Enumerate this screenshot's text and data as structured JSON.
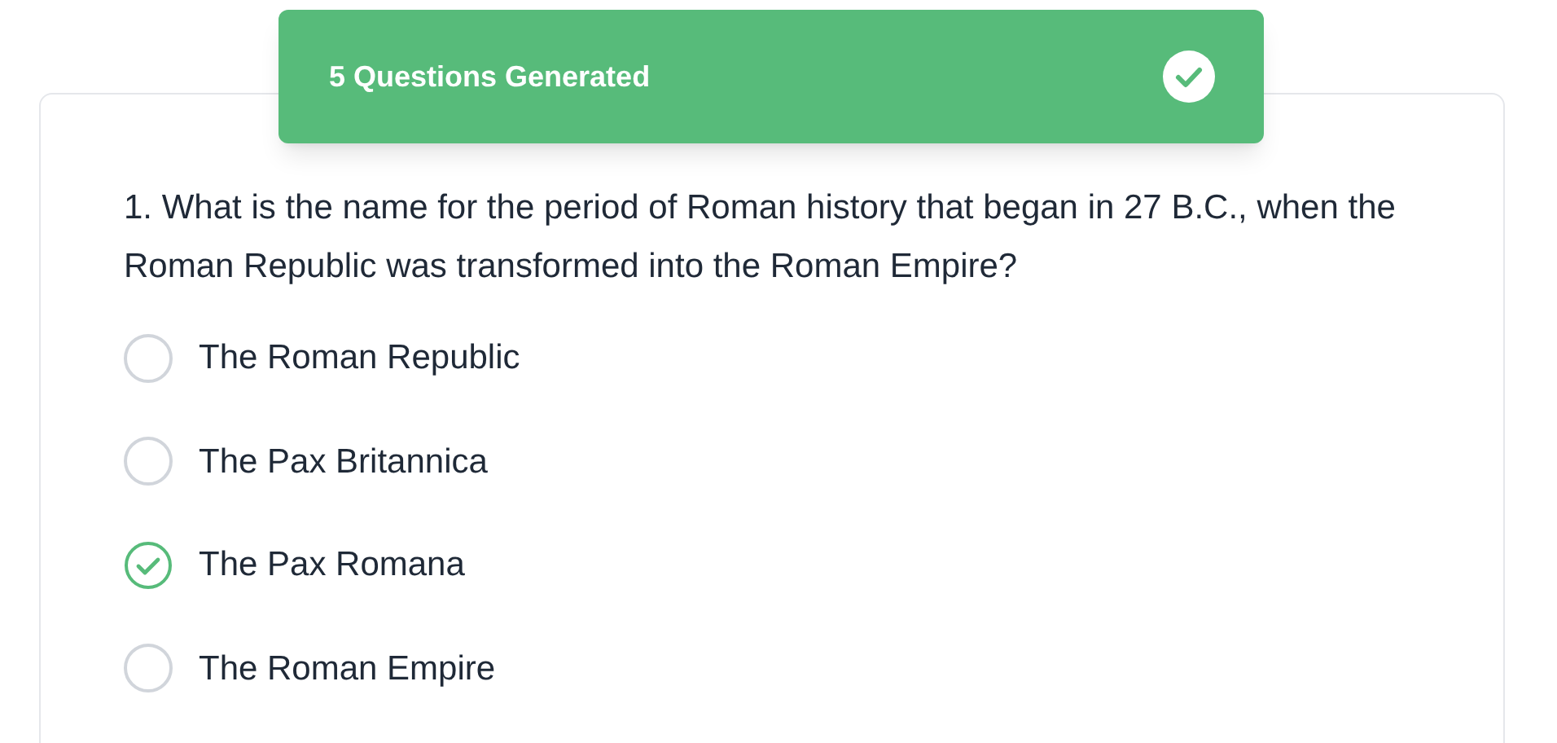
{
  "toast": {
    "message": "5 Questions Generated"
  },
  "question": {
    "text": "1. What is the name for the period of Roman history that began in 27 B.C., when the Roman Republic was transformed into the Roman Empire?",
    "options": [
      {
        "label": "The Roman Republic",
        "selected": false
      },
      {
        "label": "The Pax Britannica",
        "selected": false
      },
      {
        "label": "The Pax Romana",
        "selected": true
      },
      {
        "label": "The Roman Empire",
        "selected": false
      }
    ]
  }
}
